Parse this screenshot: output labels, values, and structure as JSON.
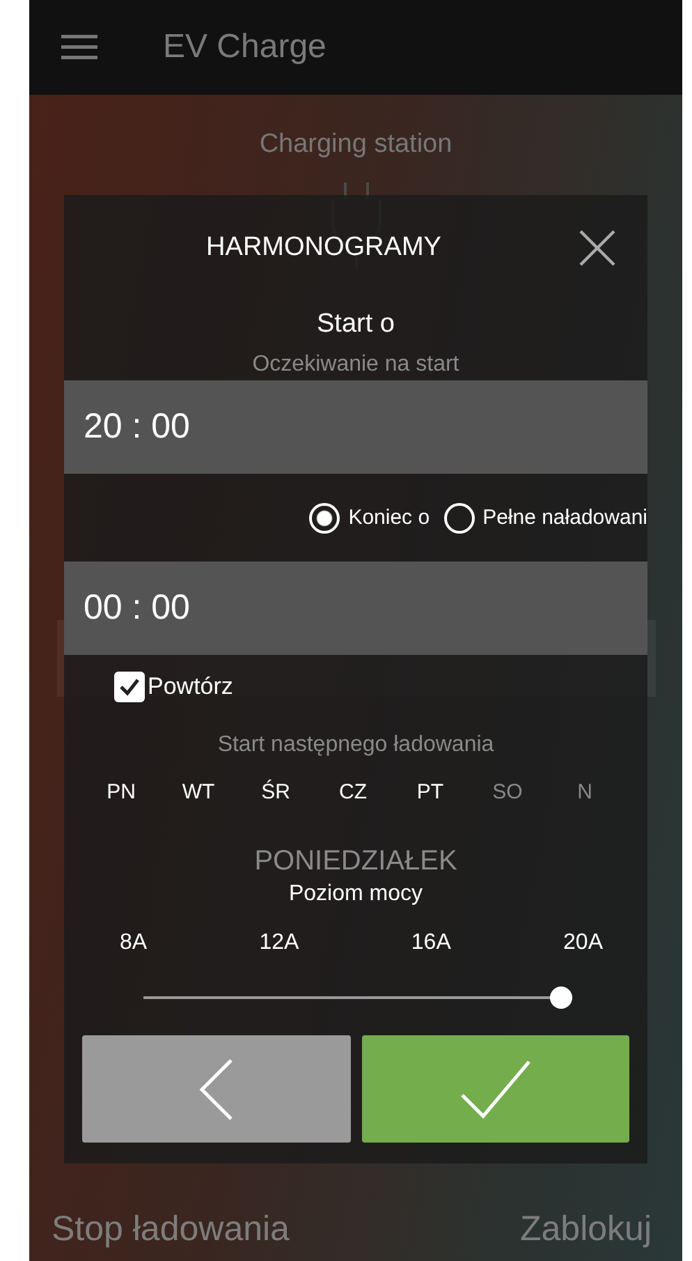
{
  "app_bar": {
    "title": "EV Charge"
  },
  "background": {
    "station_title": "Charging station",
    "status": "Oczekiwanie na start",
    "next_start_label": "Start następnego ładowania",
    "next_start_day": "PONIEDZIAŁEK",
    "actions": [
      "Stop ładowania",
      "Zablokuj"
    ]
  },
  "dialog": {
    "title": "HARMONOGRAMY",
    "start_label": "Start o",
    "start_time": "20 : 00",
    "end_options": [
      {
        "label": "Koniec o",
        "selected": true
      },
      {
        "label": "Pełne naładowani",
        "selected": false
      }
    ],
    "end_time": "00 : 00",
    "repeat": {
      "label": "Powtórz",
      "checked": true
    },
    "days": [
      {
        "label": "PN",
        "selected": true
      },
      {
        "label": "WT",
        "selected": true
      },
      {
        "label": "ŚR",
        "selected": true
      },
      {
        "label": "CZ",
        "selected": true
      },
      {
        "label": "PT",
        "selected": true
      },
      {
        "label": "SO",
        "selected": false
      },
      {
        "label": "N",
        "selected": false
      }
    ],
    "power": {
      "title": "Poziom mocy",
      "ticks": [
        "8A",
        "12A",
        "16A",
        "20A"
      ],
      "level": 1
    },
    "buttons": [
      {
        "kind": "back"
      },
      {
        "kind": "confirm"
      }
    ]
  }
}
